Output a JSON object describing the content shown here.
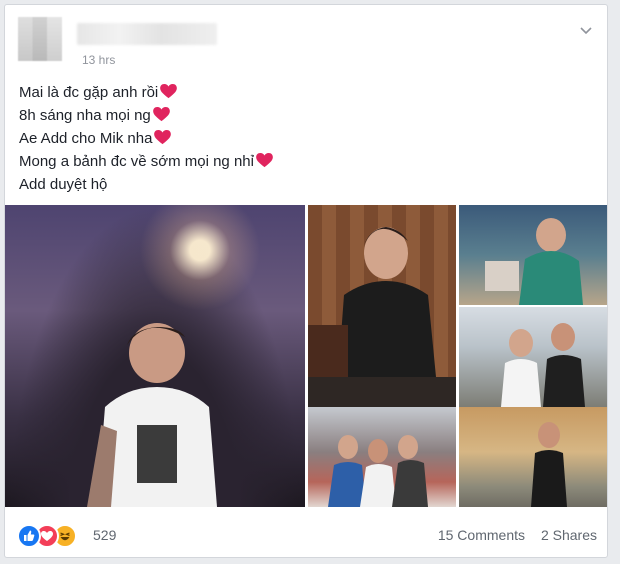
{
  "post": {
    "timestamp": "13 hrs",
    "lines": [
      "Mai là đc gặp anh rồi",
      "8h sáng nha mọi ng",
      "Ae Add cho Mik nha",
      "Mong a bảnh đc về sớm mọi ng nhỉ",
      "Add duyệt hộ"
    ]
  },
  "reactions": {
    "icons": [
      "like-icon",
      "love-icon",
      "haha-icon"
    ],
    "count": "529"
  },
  "footer": {
    "comments": "15 Comments",
    "shares": "2 Shares"
  },
  "colors": {
    "like": "#1877f2",
    "love": "#f33e58",
    "haha": "#f7b125",
    "heart": "#e0245e"
  }
}
